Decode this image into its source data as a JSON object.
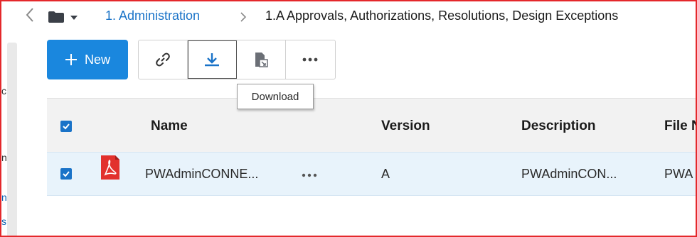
{
  "left_fragments": [
    "c",
    "n",
    "n",
    "s"
  ],
  "breadcrumb": {
    "root": "1. Administration",
    "current": "1.A Approvals, Authorizations, Resolutions, Design Exceptions"
  },
  "toolbar": {
    "new_label": "New",
    "tooltip": "Download"
  },
  "table": {
    "headers": {
      "name": "Name",
      "version": "Version",
      "description": "Description",
      "file": "File N"
    },
    "rows": [
      {
        "name": "PWAdminCONNE...",
        "version": "A",
        "description": "PWAdminCON...",
        "file": "PWA"
      }
    ]
  },
  "colors": {
    "accent": "#1a87de",
    "link": "#1a73c8",
    "pdf_red": "#e2312d",
    "selected_row": "#e8f3fb",
    "frame": "#e4282b"
  }
}
